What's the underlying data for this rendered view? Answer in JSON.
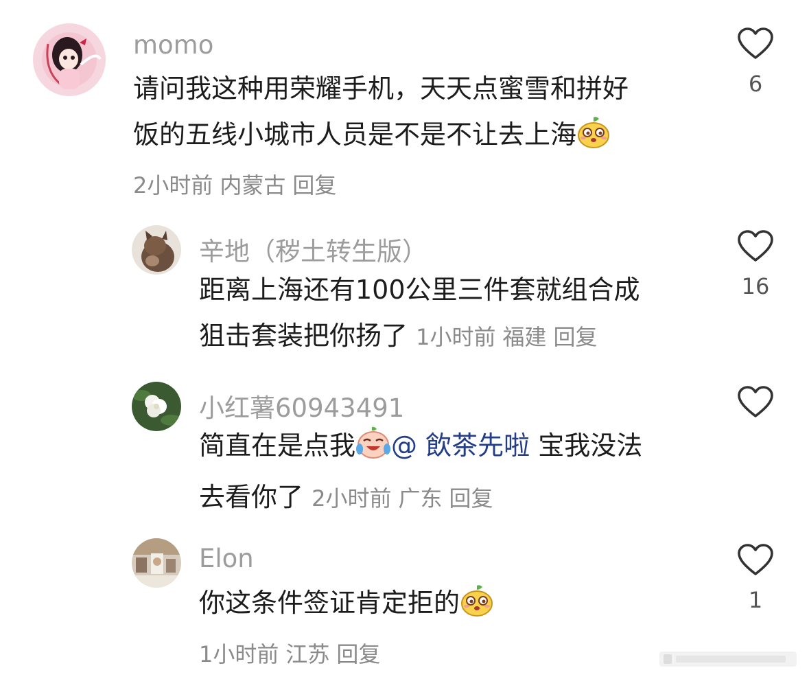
{
  "comments": [
    {
      "username": "momo",
      "text_part1": "请问我这种用荣耀手机，天天点蜜雪和拼好",
      "text_part2": "饭的五线小城市人员是不是不让去上海",
      "emoji": "smug-fruit-emoji",
      "time": "2小时前",
      "location": "内蒙古",
      "reply_label": "回复",
      "likes": "6"
    },
    {
      "username": "辛地（秽土转生版）",
      "text_line1": "距离上海还有100公里三件套就组合成",
      "text_line2": "狙击套装把你扬了",
      "time": "1小时前",
      "location": "福建",
      "reply_label": "回复",
      "likes": "16"
    },
    {
      "username": "小红薯60943491",
      "text_part1": "简直在是点我",
      "emoji": "crying-laugh-emoji",
      "mention": "@ 飲茶先啦",
      "text_part2": " 宝我没法",
      "text_line2": "去看你了",
      "time": "2小时前",
      "location": "广东",
      "reply_label": "回复",
      "likes": ""
    },
    {
      "username": "Elon",
      "text": "你这条件签证肯定拒的",
      "emoji": "smug-fruit-emoji",
      "time": "1小时前",
      "location": "江苏",
      "reply_label": "回复",
      "likes": "1"
    }
  ],
  "colors": {
    "username": "#9c9c9c",
    "meta": "#8a8a8a",
    "mention": "#233e86",
    "text": "#1c1c1c"
  }
}
